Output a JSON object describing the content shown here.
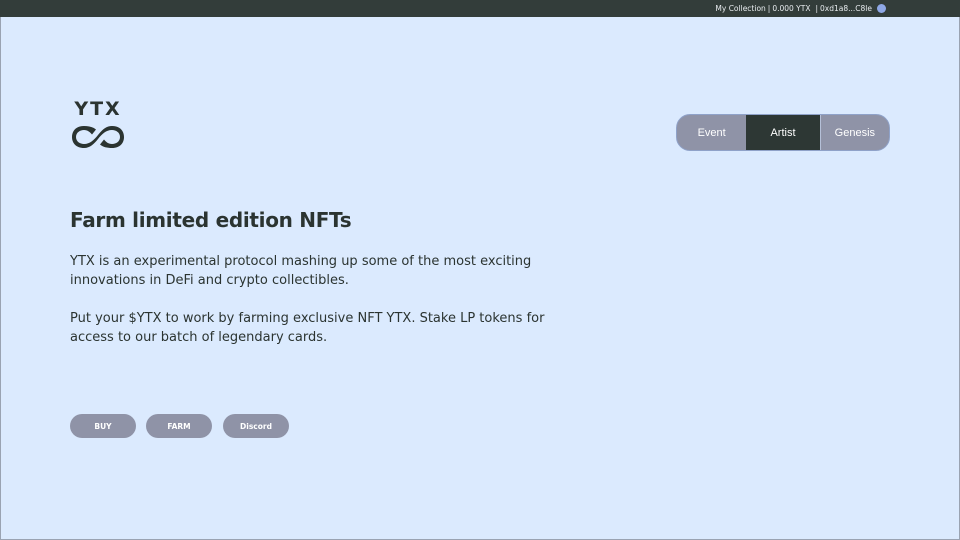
{
  "topbar": {
    "collection": "My Collection",
    "sep1": "|",
    "balance": "0.000 YTX",
    "sep2": "|",
    "address": "0xd1a8...C8le"
  },
  "logo": {
    "text": "YTX"
  },
  "tabs": [
    {
      "label": "Event",
      "active": false
    },
    {
      "label": "Artist",
      "active": true
    },
    {
      "label": "Genesis",
      "active": false
    }
  ],
  "hero": {
    "title": "Farm limited edition NFTs",
    "paragraph1": "YTX is an experimental protocol mashing up some of the most exciting innovations in DeFi and crypto collectibles.",
    "paragraph2": "Put your $YTX to work by farming exclusive NFT YTX. Stake LP tokens for access to our batch of legendary cards."
  },
  "buttons": {
    "buy": "BUY",
    "farm": "FARM",
    "discord": "Discord"
  },
  "colors": {
    "background": "#dbeafe",
    "topbar": "#333d3a",
    "text": "#2b3431",
    "button": "#8f93a7",
    "active_tab": "#2d3734",
    "wallet_dot": "#8fa8e6"
  },
  "icons": {
    "logo": "infinity-logo-icon",
    "wallet": "wallet-avatar-dot"
  }
}
